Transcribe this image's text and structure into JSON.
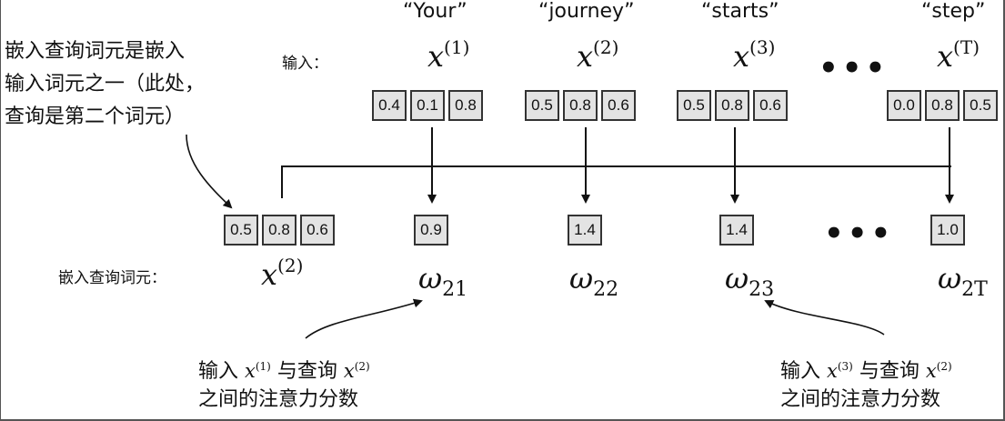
{
  "tokens": [
    "“Your”",
    "“journey”",
    "“starts”",
    "“step”"
  ],
  "input_label": "输入：",
  "query_label": "嵌入查询词元：",
  "top_note": [
    "嵌入查询词元是嵌入",
    "输入词元之一（此处，",
    "查询是第二个词元）"
  ],
  "inputs": [
    {
      "var": "x",
      "sup": "(1)",
      "values": [
        "0.4",
        "0.1",
        "0.8"
      ]
    },
    {
      "var": "x",
      "sup": "(2)",
      "values": [
        "0.5",
        "0.8",
        "0.6"
      ]
    },
    {
      "var": "x",
      "sup": "(3)",
      "values": [
        "0.5",
        "0.8",
        "0.6"
      ]
    },
    {
      "var": "x",
      "sup": "(T)",
      "values": [
        "0.0",
        "0.8",
        "0.5"
      ]
    }
  ],
  "ellipsis": "•••",
  "query": {
    "var": "x",
    "sup": "(2)",
    "values": [
      "0.5",
      "0.8",
      "0.6"
    ]
  },
  "scores": [
    {
      "value": "0.9",
      "var": "ω",
      "sub": "21"
    },
    {
      "value": "1.4",
      "var": "ω",
      "sub": "22"
    },
    {
      "value": "1.4",
      "var": "ω",
      "sub": "23"
    },
    {
      "value": "1.0",
      "var": "ω",
      "sub": "2T"
    }
  ],
  "bottom_left_note": {
    "prefix": "输入 ",
    "x1_var": "x",
    "x1_sup": "(1)",
    "middle": " 与查询 ",
    "x2_var": "x",
    "x2_sup": "(2)",
    "line2": "之间的注意力分数"
  },
  "bottom_right_note": {
    "prefix": "输入 ",
    "x1_var": "x",
    "x1_sup": "(3)",
    "middle": " 与查询 ",
    "x2_var": "x",
    "x2_sup": "(2)",
    "line2": "之间的注意力分数"
  }
}
